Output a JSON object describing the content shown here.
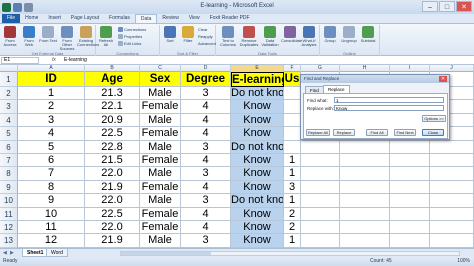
{
  "window": {
    "title": "E-learning - Microsoft Excel",
    "close_glyph": "✕",
    "minimize_glyph": "–",
    "maximize_glyph": "□"
  },
  "ribbon": {
    "tabs": [
      "File",
      "Home",
      "Insert",
      "Page Layout",
      "Formulas",
      "Data",
      "Review",
      "View",
      "Foxit Reader PDF"
    ],
    "active_tab": "Data",
    "groups": [
      {
        "label": "Get External Data",
        "buttons": [
          "From Access",
          "From Web",
          "From Text",
          "From Other Sources",
          "Existing Connections"
        ]
      },
      {
        "label": "Connections",
        "buttons": [
          "Refresh All"
        ],
        "small": [
          "Connections",
          "Properties",
          "Edit Links"
        ]
      },
      {
        "label": "Sort & Filter",
        "buttons": [
          "Sort",
          "Filter"
        ],
        "small": [
          "Clear",
          "Reapply",
          "Advanced"
        ]
      },
      {
        "label": "Data Tools",
        "buttons": [
          "Text to Columns",
          "Remove Duplicates",
          "Data Validation",
          "Consolidate",
          "What-If Analysis"
        ]
      },
      {
        "label": "Outline",
        "buttons": [
          "Group",
          "Ungroup",
          "Subtotal"
        ]
      }
    ]
  },
  "formula_bar": {
    "name_box": "E1",
    "fx": "fx",
    "value": "E-learning"
  },
  "columns": [
    "A",
    "B",
    "C",
    "D",
    "E",
    "F",
    "G",
    "H",
    "I",
    "J"
  ],
  "selected_column": "E",
  "headers": [
    "ID",
    "Age",
    "Sex",
    "Degree",
    "E-learning",
    "Us"
  ],
  "rows": [
    {
      "n": "2",
      "cells": [
        "1",
        "21.3",
        "Male",
        "3",
        "Do not know",
        ""
      ]
    },
    {
      "n": "3",
      "cells": [
        "2",
        "22.1",
        "Female",
        "4",
        "Know",
        ""
      ]
    },
    {
      "n": "4",
      "cells": [
        "3",
        "20.9",
        "Male",
        "4",
        "Know",
        ""
      ]
    },
    {
      "n": "5",
      "cells": [
        "4",
        "22.5",
        "Female",
        "4",
        "Know",
        ""
      ]
    },
    {
      "n": "6",
      "cells": [
        "5",
        "22.8",
        "Male",
        "3",
        "Do not know",
        ""
      ]
    },
    {
      "n": "7",
      "cells": [
        "6",
        "21.5",
        "Female",
        "4",
        "Know",
        "1"
      ]
    },
    {
      "n": "8",
      "cells": [
        "7",
        "22.0",
        "Male",
        "3",
        "Know",
        "1"
      ]
    },
    {
      "n": "9",
      "cells": [
        "8",
        "21.9",
        "Female",
        "4",
        "Know",
        "3"
      ]
    },
    {
      "n": "10",
      "cells": [
        "9",
        "22.0",
        "Male",
        "3",
        "Do not know",
        "1"
      ]
    },
    {
      "n": "11",
      "cells": [
        "10",
        "22.5",
        "Female",
        "4",
        "Know",
        "2"
      ]
    },
    {
      "n": "12",
      "cells": [
        "11",
        "22.0",
        "Female",
        "4",
        "Know",
        "2"
      ]
    },
    {
      "n": "13",
      "cells": [
        "12",
        "21.9",
        "Male",
        "3",
        "Know",
        "1"
      ]
    }
  ],
  "header_row_number": "1",
  "dialog": {
    "title": "Find and Replace",
    "tabs": [
      "Find",
      "Replace"
    ],
    "active_tab": "Replace",
    "find_label": "Find what:",
    "find_value": "1",
    "replace_label": "Replace with:",
    "replace_value": "Know",
    "options_label": "Options >>",
    "buttons": [
      "Replace All",
      "Replace",
      "Find All",
      "Find Next",
      "Close"
    ]
  },
  "sheets": [
    "Sheet1",
    "Word"
  ],
  "active_sheet": "Sheet1",
  "status": {
    "ready": "Ready",
    "count": "Count: 45",
    "zoom": "100%"
  },
  "colors": {
    "header_fill": "#ffff00",
    "selected_column_fill": "#b9d3ee",
    "file_tab": "#1f5fa8"
  }
}
